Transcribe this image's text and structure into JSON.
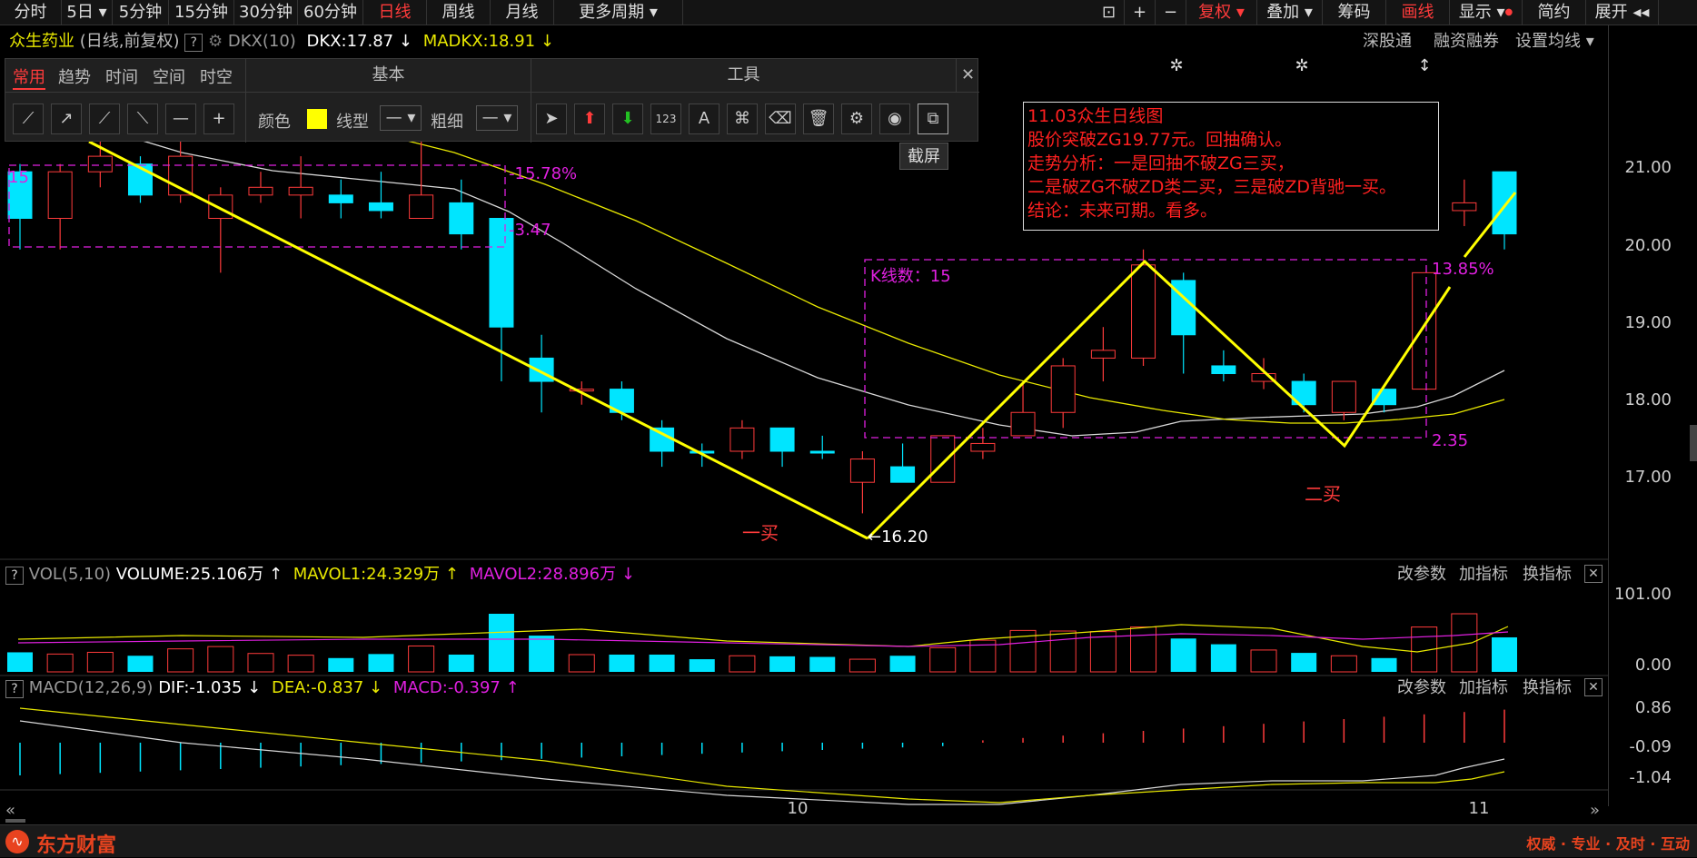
{
  "toolbar": {
    "tabs": [
      "分时",
      "5日",
      "5分钟",
      "15分钟",
      "30分钟",
      "60分钟",
      "日线",
      "周线",
      "月线",
      "更多周期"
    ],
    "active_tab": "日线",
    "right_buttons": [
      "复权",
      "叠加",
      "筹码",
      "画线",
      "显示",
      "简约",
      "展开"
    ]
  },
  "info": {
    "stock_name": "众生药业",
    "mode": "(日线,前复权)",
    "indicator": "DKX(10)",
    "dkx": "DKX:17.87",
    "madkx": "MADKX:18.91",
    "right_links": [
      "深股通",
      "融资融券",
      "设置均线"
    ]
  },
  "tool_panel": {
    "tabs": [
      "常用",
      "趋势",
      "时间",
      "空间",
      "时空"
    ],
    "section_basic": "基本",
    "section_tools": "工具",
    "color_label": "颜色",
    "line_type_label": "线型",
    "thickness_label": "粗细",
    "tooltip": "截屏"
  },
  "annotation": {
    "lines": [
      "11.03众生日线图",
      "股价突破ZG19.77元。回抽确认。",
      "走势分析：一是回抽不破ZG三买，",
      "二是破ZG不破ZD类二买，三是破ZD背驰一买。",
      "结论：未来可期。看多。"
    ]
  },
  "chart_labels": {
    "box_top_pct": "-15.78%",
    "box_bottom_pct": "-3.47",
    "box_left": "15",
    "kline_count": "K线数：15",
    "rise_pct": "13.85%",
    "box2_low": "2.35",
    "low_price": "16.20",
    "buy1": "一买",
    "buy2": "二买"
  },
  "price_axis": [
    "21.00",
    "20.00",
    "19.00",
    "18.00",
    "17.00"
  ],
  "volume_panel": {
    "label": "VOL(5,10)",
    "volume": "VOLUME:25.106万",
    "mavol1": "MAVOL1:24.329万",
    "mavol2": "MAVOL2:28.896万",
    "axis": [
      "101.00",
      "0.00"
    ],
    "buttons": [
      "改参数",
      "加指标",
      "换指标"
    ]
  },
  "macd_panel": {
    "label": "MACD(12,26,9)",
    "dif": "DIF:-1.035",
    "dea": "DEA:-0.837",
    "macd": "MACD:-0.397",
    "axis": [
      "0.86",
      "-0.09",
      "-1.04"
    ],
    "buttons": [
      "改参数",
      "加指标",
      "换指标"
    ]
  },
  "date_axis": [
    "10",
    "11"
  ],
  "footer": {
    "brand": "东方财富",
    "slogan": "权威 · 专业 · 及时 · 互动"
  },
  "colors": {
    "up": "#ff3b3b",
    "down": "#00e5ff",
    "ma_white": "#d8d8d8",
    "ma_yellow": "#e8e800",
    "pink": "#e020e0"
  },
  "chart_data": {
    "type": "candlestick",
    "candles": [
      {
        "o": 20.0,
        "c": 20.6,
        "h": 20.7,
        "l": 19.6,
        "up": false
      },
      {
        "o": 20.0,
        "c": 20.6,
        "h": 20.7,
        "l": 19.6,
        "up": true
      },
      {
        "o": 20.6,
        "c": 20.8,
        "h": 21.3,
        "l": 20.4,
        "up": true
      },
      {
        "o": 20.7,
        "c": 20.3,
        "h": 20.8,
        "l": 20.2,
        "up": false
      },
      {
        "o": 20.3,
        "c": 20.8,
        "h": 21.3,
        "l": 20.2,
        "up": true
      },
      {
        "o": 20.3,
        "c": 20.0,
        "h": 20.4,
        "l": 19.3,
        "up": true
      },
      {
        "o": 20.3,
        "c": 20.4,
        "h": 20.6,
        "l": 20.2,
        "up": true
      },
      {
        "o": 20.3,
        "c": 20.4,
        "h": 20.8,
        "l": 20.0,
        "up": true
      },
      {
        "o": 20.3,
        "c": 20.2,
        "h": 20.5,
        "l": 20.0,
        "up": false
      },
      {
        "o": 20.2,
        "c": 20.1,
        "h": 20.6,
        "l": 20.0,
        "up": false
      },
      {
        "o": 20.0,
        "c": 20.3,
        "h": 21.0,
        "l": 20.0,
        "up": true
      },
      {
        "o": 20.2,
        "c": 19.8,
        "h": 20.5,
        "l": 19.6,
        "up": false
      },
      {
        "o": 20.0,
        "c": 18.6,
        "h": 20.0,
        "l": 17.9,
        "up": false
      },
      {
        "o": 18.2,
        "c": 17.9,
        "h": 18.5,
        "l": 17.5,
        "up": false
      },
      {
        "o": 17.8,
        "c": 17.8,
        "h": 17.9,
        "l": 17.6,
        "up": true
      },
      {
        "o": 17.8,
        "c": 17.5,
        "h": 17.9,
        "l": 17.4,
        "up": false
      },
      {
        "o": 17.3,
        "c": 17.0,
        "h": 17.4,
        "l": 16.8,
        "up": false
      },
      {
        "o": 17.0,
        "c": 17.0,
        "h": 17.1,
        "l": 16.8,
        "up": false
      },
      {
        "o": 17.0,
        "c": 17.3,
        "h": 17.4,
        "l": 16.9,
        "up": true
      },
      {
        "o": 17.3,
        "c": 17.0,
        "h": 17.3,
        "l": 16.8,
        "up": false
      },
      {
        "o": 17.0,
        "c": 17.0,
        "h": 17.2,
        "l": 16.9,
        "up": false
      },
      {
        "o": 16.6,
        "c": 16.9,
        "h": 17.0,
        "l": 16.2,
        "up": true
      },
      {
        "o": 16.8,
        "c": 16.6,
        "h": 17.1,
        "l": 16.6,
        "up": false
      },
      {
        "o": 16.6,
        "c": 17.2,
        "h": 17.2,
        "l": 16.6,
        "up": true
      },
      {
        "o": 17.0,
        "c": 17.1,
        "h": 17.3,
        "l": 16.9,
        "up": true
      },
      {
        "o": 17.2,
        "c": 17.5,
        "h": 17.9,
        "l": 17.2,
        "up": true
      },
      {
        "o": 17.5,
        "c": 18.1,
        "h": 18.2,
        "l": 17.3,
        "up": true
      },
      {
        "o": 18.2,
        "c": 18.3,
        "h": 18.6,
        "l": 17.9,
        "up": true
      },
      {
        "o": 18.2,
        "c": 19.4,
        "h": 19.6,
        "l": 18.1,
        "up": true
      },
      {
        "o": 19.2,
        "c": 18.5,
        "h": 19.3,
        "l": 18.0,
        "up": false
      },
      {
        "o": 18.1,
        "c": 18.0,
        "h": 18.3,
        "l": 17.9,
        "up": false
      },
      {
        "o": 17.9,
        "c": 18.0,
        "h": 18.2,
        "l": 17.8,
        "up": true
      },
      {
        "o": 17.9,
        "c": 17.6,
        "h": 18.0,
        "l": 17.5,
        "up": false
      },
      {
        "o": 17.5,
        "c": 17.9,
        "h": 17.9,
        "l": 17.4,
        "up": true
      },
      {
        "o": 17.8,
        "c": 17.6,
        "h": 17.8,
        "l": 17.5,
        "up": false
      },
      {
        "o": 17.8,
        "c": 19.3,
        "h": 19.3,
        "l": 17.8,
        "up": true
      },
      {
        "o": 20.1,
        "c": 20.2,
        "h": 20.5,
        "l": 19.9,
        "up": true
      },
      {
        "o": 20.6,
        "c": 19.8,
        "h": 20.6,
        "l": 19.6,
        "up": false
      }
    ],
    "volumes": [
      34,
      31,
      34,
      28,
      40,
      44,
      32,
      29,
      24,
      31,
      45,
      30,
      101,
      63,
      30,
      30,
      30,
      22,
      28,
      27,
      26,
      22,
      28,
      42,
      55,
      72,
      71,
      70,
      78,
      58,
      48,
      38,
      33,
      28,
      24,
      78,
      101,
      60
    ]
  }
}
